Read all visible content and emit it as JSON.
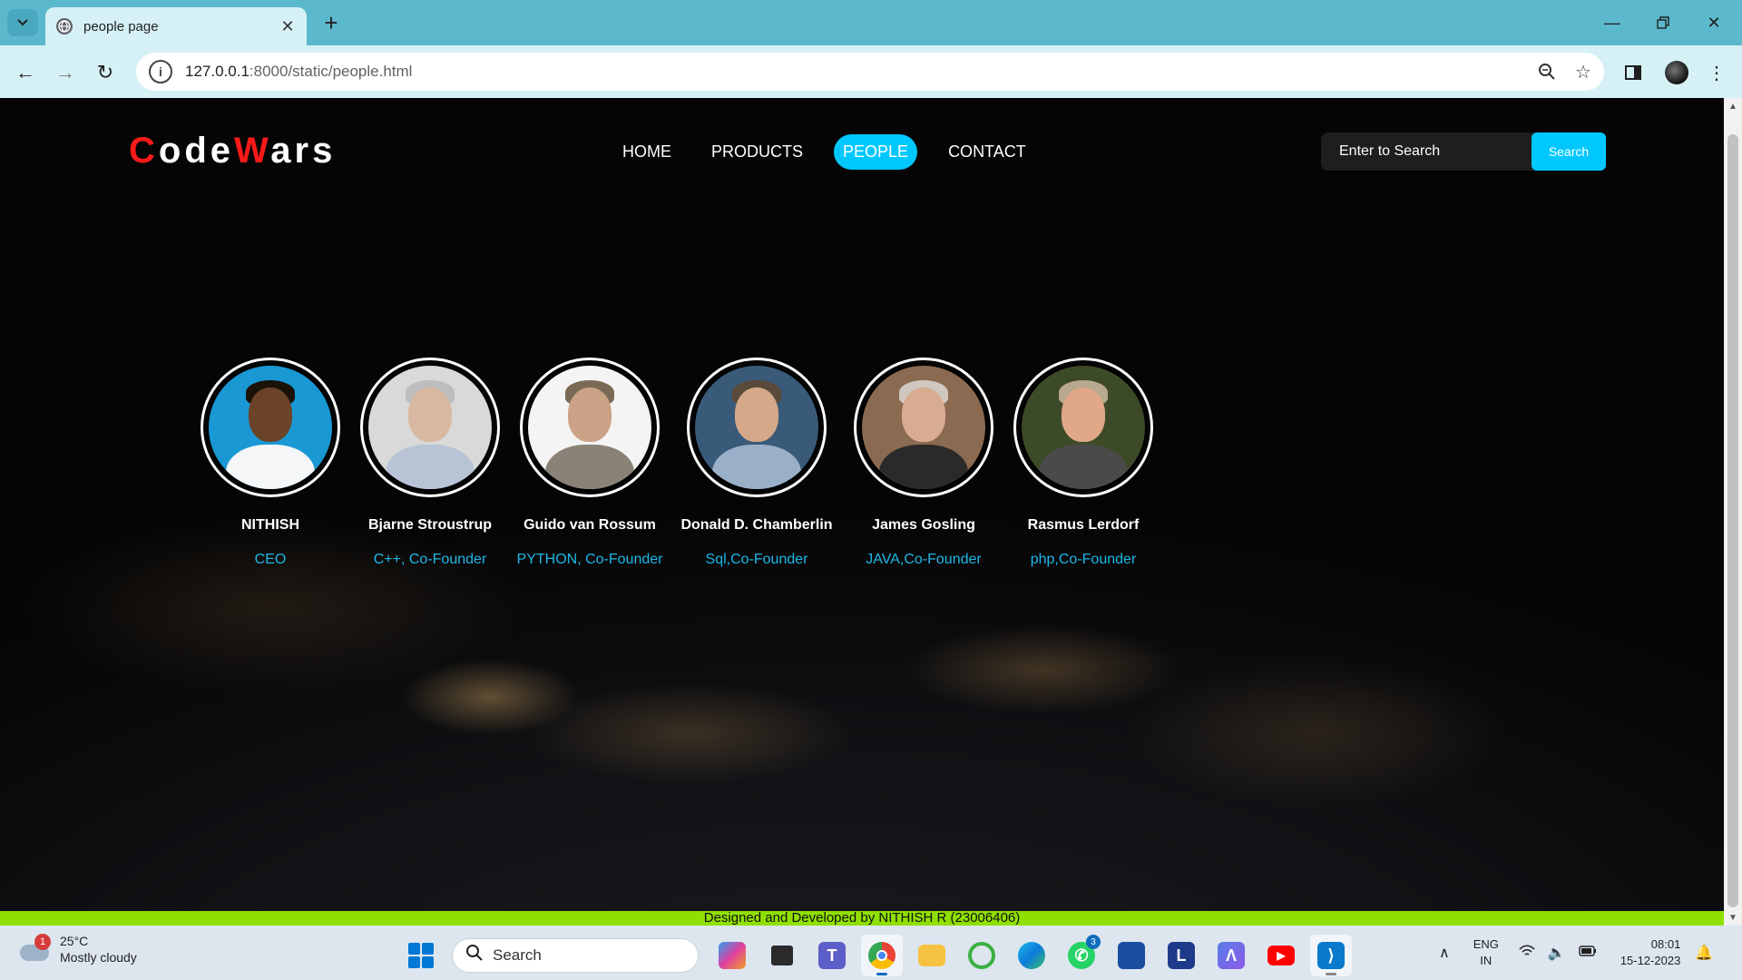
{
  "browser": {
    "tab_title": "people page",
    "url_host": "127.0.0.1",
    "url_path": ":8000/static/people.html"
  },
  "site": {
    "logo_c": "C",
    "logo_ode": "ode",
    "logo_w": "W",
    "logo_ars": "ars",
    "nav": [
      {
        "label": "HOME"
      },
      {
        "label": "PRODUCTS"
      },
      {
        "label": "PEOPLE"
      },
      {
        "label": "CONTACT"
      }
    ],
    "search_placeholder": "Enter to Search",
    "search_button": "Search",
    "accent_color": "#00c8ff",
    "logo_red": "#ff1a1a"
  },
  "people": [
    {
      "name": "NITHISH",
      "role": "CEO"
    },
    {
      "name": "Bjarne Stroustrup",
      "role": "C++, Co-Founder"
    },
    {
      "name": "Guido van Rossum",
      "role": "PYTHON, Co-Founder"
    },
    {
      "name": "Donald D. Chamberlin",
      "role": "Sql,Co-Founder"
    },
    {
      "name": "James Gosling",
      "role": "JAVA,Co-Founder"
    },
    {
      "name": "Rasmus Lerdorf",
      "role": "php,Co-Founder"
    }
  ],
  "footer": {
    "text": "Designed and Developed by NITHISH R (23006406)"
  },
  "taskbar": {
    "weather_badge": "1",
    "temperature": "25°C",
    "weather_desc": "Mostly cloudy",
    "search_text": "Search",
    "teams_badge": "3",
    "lang_line1": "ENG",
    "lang_line2": "IN",
    "time": "08:01",
    "date": "15-12-2023"
  }
}
